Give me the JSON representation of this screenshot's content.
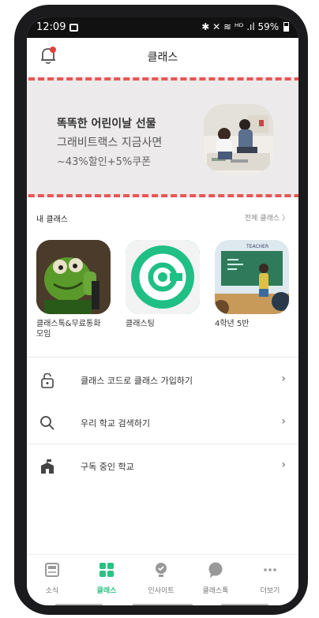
{
  "status_bar": {
    "time": "12:09",
    "indicators": "✱ ✕ ≋ ᴴᴰ .ıl 59%"
  },
  "header": {
    "title": "클래스"
  },
  "banner": {
    "line1": "똑똑한 어린이날 선물",
    "line2": "그래비트랙스 지금사면",
    "line3": "~43%할인+5%쿠폰",
    "outline_color": "#e85656"
  },
  "my_classes": {
    "title": "내 클래스",
    "more_label": "전체 클래스 〉",
    "items": [
      {
        "name": "클래스톡&무료통화\n모임"
      },
      {
        "name": "클래스팅"
      },
      {
        "name": "4학년 5반",
        "board_text": "TEACHER"
      }
    ]
  },
  "menu": [
    {
      "label": "클래스 코드로 클래스 가입하기",
      "icon": "lock-icon"
    },
    {
      "label": "우리 학교 검색하기",
      "icon": "search-icon"
    },
    {
      "label": "구독 중인 학교",
      "icon": "school-icon"
    }
  ],
  "tabs": [
    {
      "label": "소식",
      "icon": "news-icon"
    },
    {
      "label": "클래스",
      "icon": "grid-icon",
      "active": true
    },
    {
      "label": "인사이트",
      "icon": "insight-icon"
    },
    {
      "label": "클래스톡",
      "icon": "chat-icon"
    },
    {
      "label": "더보기",
      "icon": "more-icon"
    }
  ],
  "colors": {
    "accent": "#2ebf83",
    "notification_dot": "#e8403a"
  }
}
